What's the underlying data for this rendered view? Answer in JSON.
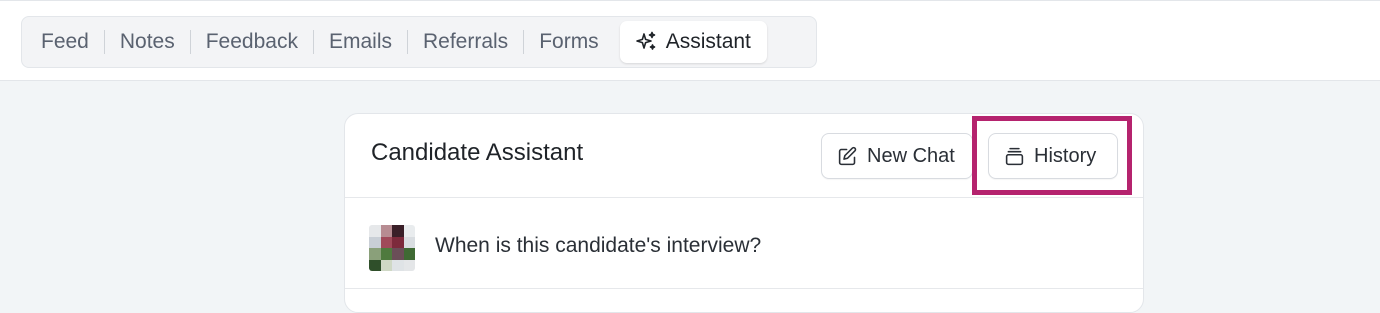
{
  "tabs": [
    {
      "label": "Feed"
    },
    {
      "label": "Notes"
    },
    {
      "label": "Feedback"
    },
    {
      "label": "Emails"
    },
    {
      "label": "Referrals"
    },
    {
      "label": "Forms"
    },
    {
      "label": "Assistant",
      "icon": "sparkle-icon",
      "active": true
    }
  ],
  "assistant": {
    "title": "Candidate Assistant",
    "new_chat_label": "New Chat",
    "new_chat_icon": "edit-icon",
    "history_label": "History",
    "history_icon": "stack-icon",
    "highlight_color": "#b5236e"
  },
  "messages": [
    {
      "author_avatar": "avatar",
      "text": "When is this candidate's interview?"
    }
  ]
}
